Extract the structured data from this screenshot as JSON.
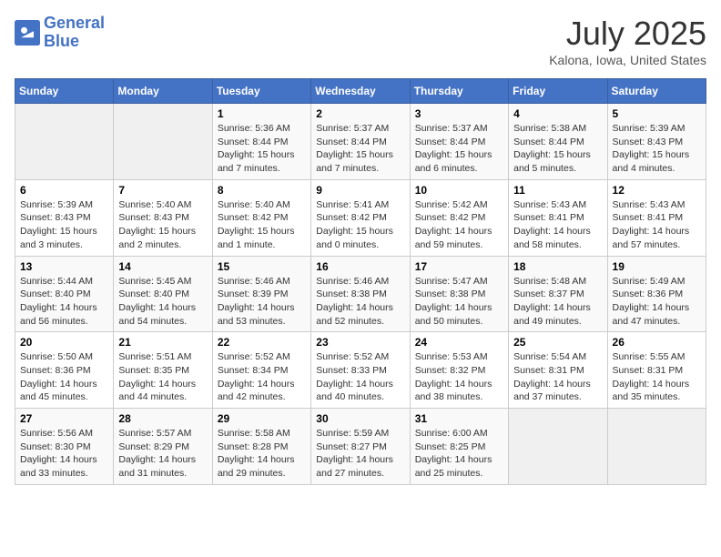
{
  "header": {
    "logo_general": "General",
    "logo_blue": "Blue",
    "month_title": "July 2025",
    "subtitle": "Kalona, Iowa, United States"
  },
  "days_of_week": [
    "Sunday",
    "Monday",
    "Tuesday",
    "Wednesday",
    "Thursday",
    "Friday",
    "Saturday"
  ],
  "weeks": [
    [
      {
        "day": "",
        "detail": ""
      },
      {
        "day": "",
        "detail": ""
      },
      {
        "day": "1",
        "detail": "Sunrise: 5:36 AM\nSunset: 8:44 PM\nDaylight: 15 hours and 7 minutes."
      },
      {
        "day": "2",
        "detail": "Sunrise: 5:37 AM\nSunset: 8:44 PM\nDaylight: 15 hours and 7 minutes."
      },
      {
        "day": "3",
        "detail": "Sunrise: 5:37 AM\nSunset: 8:44 PM\nDaylight: 15 hours and 6 minutes."
      },
      {
        "day": "4",
        "detail": "Sunrise: 5:38 AM\nSunset: 8:44 PM\nDaylight: 15 hours and 5 minutes."
      },
      {
        "day": "5",
        "detail": "Sunrise: 5:39 AM\nSunset: 8:43 PM\nDaylight: 15 hours and 4 minutes."
      }
    ],
    [
      {
        "day": "6",
        "detail": "Sunrise: 5:39 AM\nSunset: 8:43 PM\nDaylight: 15 hours and 3 minutes."
      },
      {
        "day": "7",
        "detail": "Sunrise: 5:40 AM\nSunset: 8:43 PM\nDaylight: 15 hours and 2 minutes."
      },
      {
        "day": "8",
        "detail": "Sunrise: 5:40 AM\nSunset: 8:42 PM\nDaylight: 15 hours and 1 minute."
      },
      {
        "day": "9",
        "detail": "Sunrise: 5:41 AM\nSunset: 8:42 PM\nDaylight: 15 hours and 0 minutes."
      },
      {
        "day": "10",
        "detail": "Sunrise: 5:42 AM\nSunset: 8:42 PM\nDaylight: 14 hours and 59 minutes."
      },
      {
        "day": "11",
        "detail": "Sunrise: 5:43 AM\nSunset: 8:41 PM\nDaylight: 14 hours and 58 minutes."
      },
      {
        "day": "12",
        "detail": "Sunrise: 5:43 AM\nSunset: 8:41 PM\nDaylight: 14 hours and 57 minutes."
      }
    ],
    [
      {
        "day": "13",
        "detail": "Sunrise: 5:44 AM\nSunset: 8:40 PM\nDaylight: 14 hours and 56 minutes."
      },
      {
        "day": "14",
        "detail": "Sunrise: 5:45 AM\nSunset: 8:40 PM\nDaylight: 14 hours and 54 minutes."
      },
      {
        "day": "15",
        "detail": "Sunrise: 5:46 AM\nSunset: 8:39 PM\nDaylight: 14 hours and 53 minutes."
      },
      {
        "day": "16",
        "detail": "Sunrise: 5:46 AM\nSunset: 8:38 PM\nDaylight: 14 hours and 52 minutes."
      },
      {
        "day": "17",
        "detail": "Sunrise: 5:47 AM\nSunset: 8:38 PM\nDaylight: 14 hours and 50 minutes."
      },
      {
        "day": "18",
        "detail": "Sunrise: 5:48 AM\nSunset: 8:37 PM\nDaylight: 14 hours and 49 minutes."
      },
      {
        "day": "19",
        "detail": "Sunrise: 5:49 AM\nSunset: 8:36 PM\nDaylight: 14 hours and 47 minutes."
      }
    ],
    [
      {
        "day": "20",
        "detail": "Sunrise: 5:50 AM\nSunset: 8:36 PM\nDaylight: 14 hours and 45 minutes."
      },
      {
        "day": "21",
        "detail": "Sunrise: 5:51 AM\nSunset: 8:35 PM\nDaylight: 14 hours and 44 minutes."
      },
      {
        "day": "22",
        "detail": "Sunrise: 5:52 AM\nSunset: 8:34 PM\nDaylight: 14 hours and 42 minutes."
      },
      {
        "day": "23",
        "detail": "Sunrise: 5:52 AM\nSunset: 8:33 PM\nDaylight: 14 hours and 40 minutes."
      },
      {
        "day": "24",
        "detail": "Sunrise: 5:53 AM\nSunset: 8:32 PM\nDaylight: 14 hours and 38 minutes."
      },
      {
        "day": "25",
        "detail": "Sunrise: 5:54 AM\nSunset: 8:31 PM\nDaylight: 14 hours and 37 minutes."
      },
      {
        "day": "26",
        "detail": "Sunrise: 5:55 AM\nSunset: 8:31 PM\nDaylight: 14 hours and 35 minutes."
      }
    ],
    [
      {
        "day": "27",
        "detail": "Sunrise: 5:56 AM\nSunset: 8:30 PM\nDaylight: 14 hours and 33 minutes."
      },
      {
        "day": "28",
        "detail": "Sunrise: 5:57 AM\nSunset: 8:29 PM\nDaylight: 14 hours and 31 minutes."
      },
      {
        "day": "29",
        "detail": "Sunrise: 5:58 AM\nSunset: 8:28 PM\nDaylight: 14 hours and 29 minutes."
      },
      {
        "day": "30",
        "detail": "Sunrise: 5:59 AM\nSunset: 8:27 PM\nDaylight: 14 hours and 27 minutes."
      },
      {
        "day": "31",
        "detail": "Sunrise: 6:00 AM\nSunset: 8:25 PM\nDaylight: 14 hours and 25 minutes."
      },
      {
        "day": "",
        "detail": ""
      },
      {
        "day": "",
        "detail": ""
      }
    ]
  ]
}
